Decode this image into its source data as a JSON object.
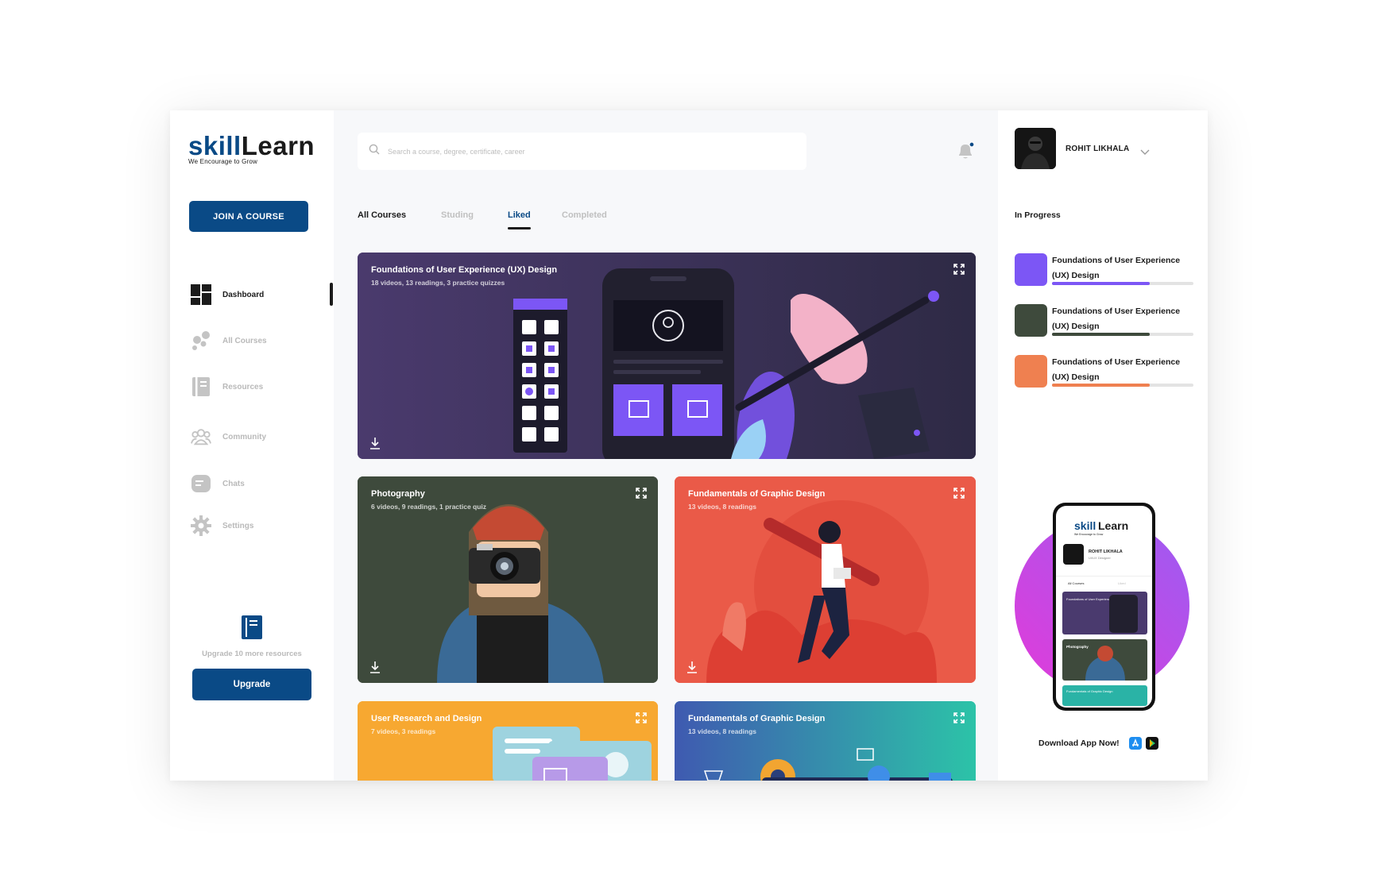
{
  "brand": {
    "name_part1": "skill",
    "name_part2": "Learn",
    "tagline": "We Encourage to Grow"
  },
  "sidebar": {
    "join_label": "JOIN A COURSE",
    "items": [
      {
        "label": "Dashboard",
        "icon": "dashboard-icon",
        "active": true
      },
      {
        "label": "All Courses",
        "icon": "courses-icon",
        "active": false
      },
      {
        "label": "Resources",
        "icon": "resources-icon",
        "active": false
      },
      {
        "label": "Community",
        "icon": "community-icon",
        "active": false
      },
      {
        "label": "Chats",
        "icon": "chat-icon",
        "active": false
      },
      {
        "label": "Settings",
        "icon": "gear-icon",
        "active": false
      }
    ],
    "upgrade_text": "Upgrade 10 more resources",
    "upgrade_label": "Upgrade"
  },
  "search": {
    "placeholder": "Search a course, degree, certificate, career",
    "value": ""
  },
  "tabs": [
    {
      "label": "All Courses"
    },
    {
      "label": "Studing"
    },
    {
      "label": "Liked",
      "active": true
    },
    {
      "label": "Completed"
    }
  ],
  "courses": [
    {
      "title": "Foundations of User Experience (UX) Design",
      "meta": "18 videos, 13 readings, 3 practice quizzes",
      "color": "#4a3a6e"
    },
    {
      "title": "Photography",
      "meta": "6 videos, 9 readings, 1 practice quiz",
      "color": "#3e4a3c"
    },
    {
      "title": "Fundamentals of Graphic Design",
      "meta": "13 videos, 8 readings",
      "color": "#ea5a48"
    },
    {
      "title": "User Research and Design",
      "meta": "7 videos, 3 readings",
      "color": "#f7a831"
    },
    {
      "title": "Fundamentals of Graphic Design",
      "meta": "13 videos, 8 readings",
      "color": "#2ab3a6"
    }
  ],
  "profile": {
    "name": "ROHIT LIKHALA"
  },
  "in_progress": {
    "title": "In Progress",
    "items": [
      {
        "title": "Foundations of User Experience (UX) Design",
        "progress": 0.69,
        "color": "#7c56f5"
      },
      {
        "title": "Foundations of User Experience (UX) Design",
        "progress": 0.69,
        "color": "#3e4a3c"
      },
      {
        "title": "Foundations of User Experience (UX) Design",
        "progress": 0.69,
        "color": "#ef8050"
      }
    ]
  },
  "phone_preview": {
    "brand_part1": "skill",
    "brand_part2": "Learn",
    "tagline": "We Encourage to Grow",
    "name": "ROHIT LIKHALA",
    "role": "UI/UX Designer",
    "tab1": "All Courses",
    "tab2": "Liked",
    "card1": "Foundations of User Experience (UX) Design",
    "card2": "Photography",
    "card3": "Fundamentals of Graphic Design"
  },
  "download_app": {
    "label": "Download App Now!"
  },
  "colors": {
    "primary": "#0a4a86",
    "text": "#1b1b1b",
    "muted": "#b9b9b9"
  }
}
